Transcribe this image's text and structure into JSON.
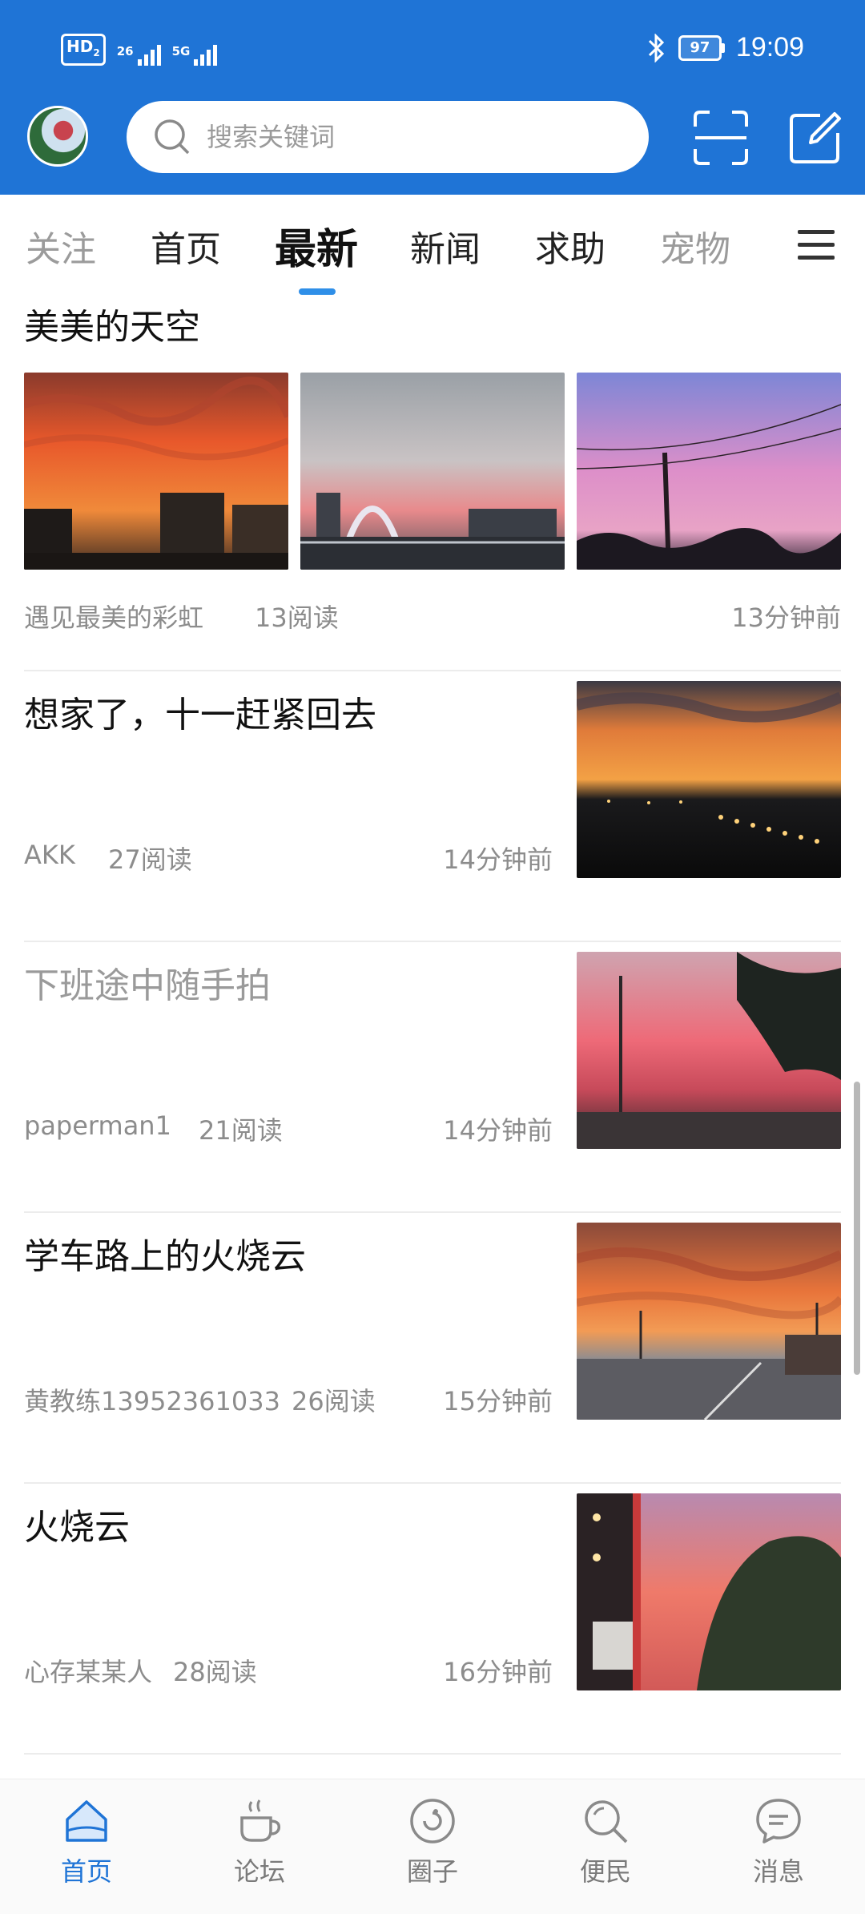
{
  "status_bar": {
    "hd_label": "HD",
    "hd_sub": "2",
    "sig1_label": "26",
    "sig2_label": "5G",
    "battery": "97",
    "time": "19:09"
  },
  "search": {
    "placeholder": "搜索关键词"
  },
  "tabs": [
    {
      "label": "关注",
      "state": "faded"
    },
    {
      "label": "首页",
      "state": "normal"
    },
    {
      "label": "最新",
      "state": "active"
    },
    {
      "label": "新闻",
      "state": "normal"
    },
    {
      "label": "求助",
      "state": "normal"
    },
    {
      "label": "宠物",
      "state": "faded"
    }
  ],
  "feed": {
    "first": {
      "title": "美美的天空",
      "source": "遇见最美的彩虹",
      "reads": "13阅读",
      "time": "13分钟前"
    },
    "items": [
      {
        "title": "想家了，十一赶紧回去",
        "source": "AKK",
        "reads": "27阅读",
        "time": "14分钟前",
        "read": false
      },
      {
        "title": "下班途中随手拍",
        "source": "paperman1",
        "reads": "21阅读",
        "time": "14分钟前",
        "read": true
      },
      {
        "title": "学车路上的火烧云",
        "source": "黄教练13952361033",
        "reads": "26阅读",
        "time": "15分钟前",
        "read": false
      },
      {
        "title": "火烧云",
        "source": "心存某某人",
        "reads": "28阅读",
        "time": "16分钟前",
        "read": false
      }
    ]
  },
  "bottom_nav": [
    {
      "label": "首页",
      "icon": "home-icon",
      "active": true
    },
    {
      "label": "论坛",
      "icon": "coffee-cup-icon",
      "active": false
    },
    {
      "label": "圈子",
      "icon": "circle-icon",
      "active": false
    },
    {
      "label": "便民",
      "icon": "search-icon",
      "active": false
    },
    {
      "label": "消息",
      "icon": "message-icon",
      "active": false
    }
  ],
  "colors": {
    "brand": "#1f74d6",
    "tab_indicator": "#2f8fe8"
  }
}
